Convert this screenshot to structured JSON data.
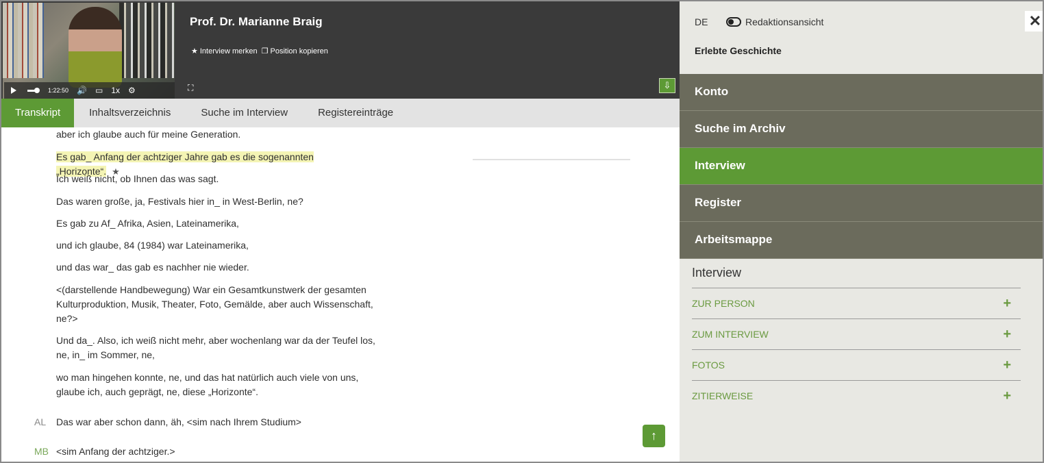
{
  "player": {
    "title": "Prof. Dr. Marianne Braig",
    "actions": {
      "bookmark": "Interview merken",
      "copy_position": "Position kopieren"
    },
    "time": "1:22:50",
    "rate": "1x"
  },
  "tabs": [
    "Transkript",
    "Inhaltsverzeichnis",
    "Suche im Interview",
    "Registereinträge"
  ],
  "transcript": {
    "lines": [
      "aber ich glaube auch für meine Generation.",
      "Es gab_ Anfang der achtziger Jahre gab es die sogenannten „Horizonte“.",
      "Ich weiß nicht, ob Ihnen das was sagt.",
      "Das waren große, ja, Festivals hier in_ in West-Berlin, ne?",
      "Es gab zu Af_ Afrika, Asien, Lateinamerika,",
      "und ich glaube, 84 (1984) war Lateinamerika,",
      "und das war_ das gab es nachher nie wieder.",
      "<(darstellende Handbewegung) War ein Gesamtkunstwerk der gesamten Kulturproduktion, Musik, Theater, Foto, Gemälde, aber auch Wissenschaft, ne?>",
      "Und da_. Also, ich weiß nicht mehr, aber wochenlang war da der Teufel los, ne, in_ im Sommer, ne,",
      "wo man hingehen konnte, ne, und das hat natürlich auch viele von uns, glaube ich, auch geprägt, ne, diese „Horizonte“."
    ],
    "al_speaker": "AL",
    "al_line": "Das war aber schon dann, äh, <sim nach Ihrem Studium>",
    "mb_speaker": "MB",
    "mb_line": "<sim Anfang der achtziger.>"
  },
  "sidebar": {
    "lang": "DE",
    "toggle_label": "Redaktionsansicht",
    "subtitle": "Erlebte Geschichte",
    "nav": [
      "Konto",
      "Suche im Archiv",
      "Interview",
      "Register",
      "Arbeitsmappe"
    ],
    "section_title": "Interview",
    "accordion": [
      "ZUR PERSON",
      "ZUM INTERVIEW",
      "FOTOS",
      "ZITIERWEISE"
    ]
  },
  "colors": {
    "accent": "#5d9a35",
    "nav": "#6b6b5c",
    "highlight": "#f4f4b4"
  }
}
